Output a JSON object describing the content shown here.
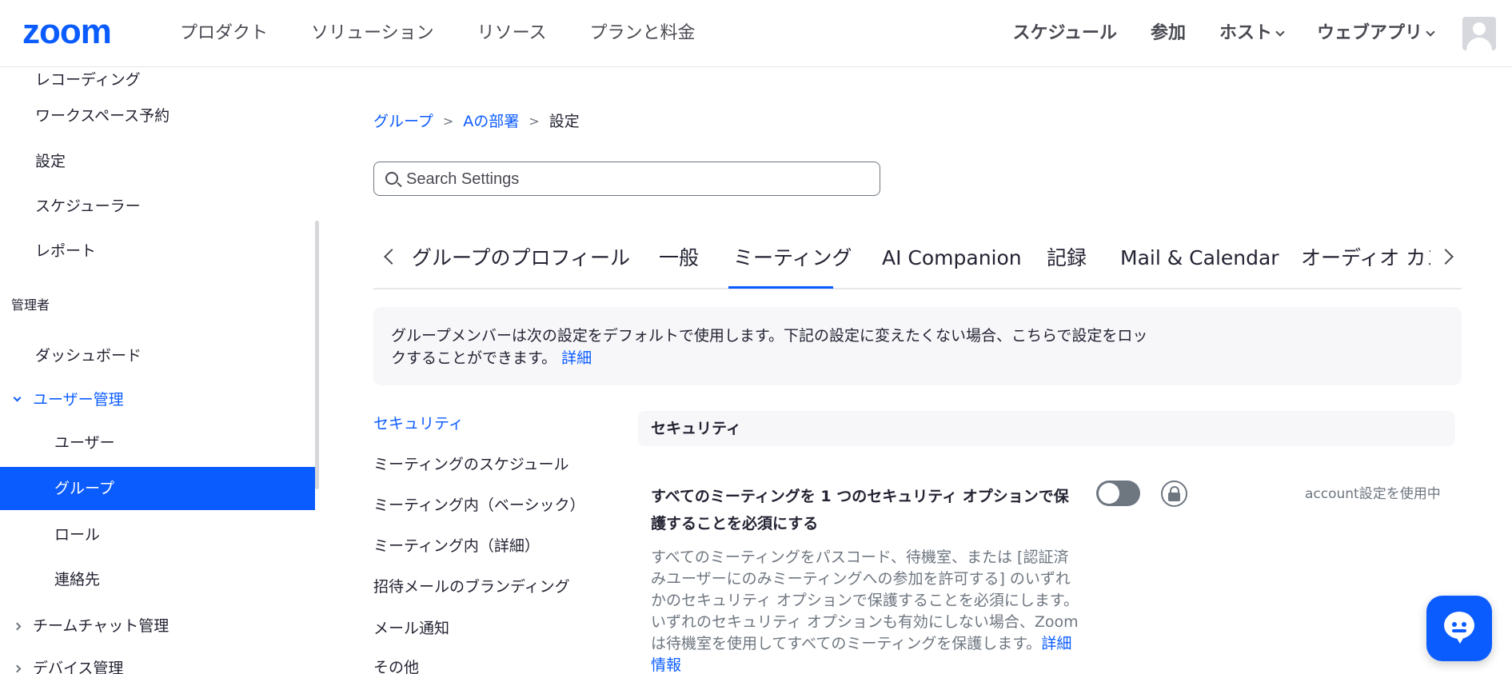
{
  "nav": {
    "logo": "zoom",
    "left": [
      "プロダクト",
      "ソリューション",
      "リソース",
      "プランと料金"
    ],
    "schedule": "スケジュール",
    "join": "参加",
    "host": "ホスト",
    "webapp": "ウェブアプリ"
  },
  "sidebar": {
    "recording": "レコーディング",
    "workspace": "ワークスペース予約",
    "settings": "設定",
    "scheduler": "スケジューラー",
    "reports": "レポート",
    "admin_header": "管理者",
    "dashboard": "ダッシュボード",
    "user_mgmt": "ユーザー管理",
    "users": "ユーザー",
    "groups": "グループ",
    "roles": "ロール",
    "contacts": "連絡先",
    "team_chat": "チームチャット管理",
    "devices": "デバイス管理"
  },
  "breadcrumb": {
    "group": "グループ",
    "dept": "Aの部署",
    "current": "設定",
    "sep": ">"
  },
  "search": {
    "placeholder": "Search Settings"
  },
  "tabs": {
    "profile": "グループのプロフィール",
    "general": "一般",
    "meeting": "ミーティング",
    "ai": "AI Companion",
    "record": "記録",
    "mail": "Mail & Calendar",
    "audio": "オーディオ カンファレンス"
  },
  "notice": {
    "text": "グループメンバーは次の設定をデフォルトで使用します。下記の設定に変えたくない場合、こちらで設定をロックすることができます。",
    "more": "詳細"
  },
  "subnav": {
    "security": "セキュリティ",
    "schedule": "ミーティングのスケジュール",
    "in_basic": "ミーティング内（ベーシック）",
    "in_adv": "ミーティング内（詳細）",
    "branding": "招待メールのブランディング",
    "email": "メール通知",
    "other": "その他"
  },
  "section": {
    "title": "セキュリティ"
  },
  "setting": {
    "title": "すべてのミーティングを 1 つのセキュリティ オプションで保護することを必須にする",
    "desc": "すべてのミーティングをパスコード、待機室、または [認証済みユーザーにのみミーティングへの参加を許可する] のいずれかのセキュリティ オプションで保護することを必須にします。いずれのセキュリティ オプションも有効にしない場合、Zoom は待機室を使用してすべてのミーティングを保護します。",
    "link": "詳細情報",
    "usage": "account設定を使用中",
    "enabled": false
  },
  "colors": {
    "accent": "#0b5cff",
    "text": "#232333",
    "muted": "#6e7680"
  }
}
